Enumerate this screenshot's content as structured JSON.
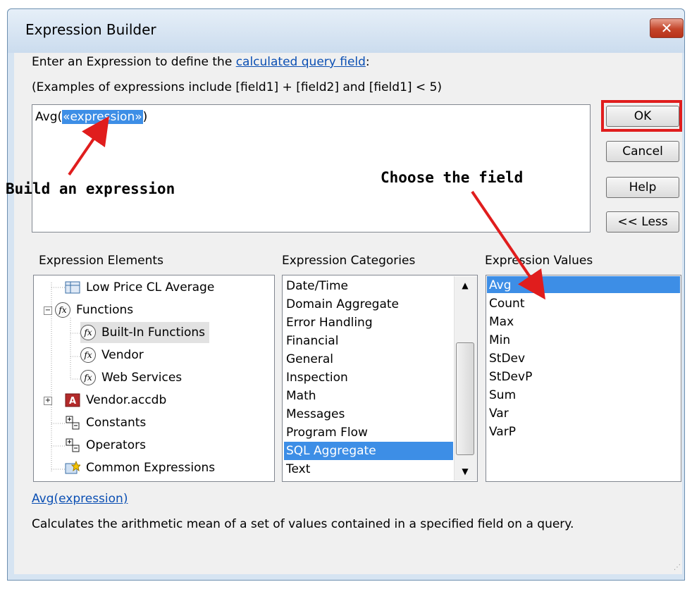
{
  "window": {
    "title": "Expression Builder",
    "close_glyph": "✕"
  },
  "intro": {
    "line1_prefix": "Enter an Expression to define the ",
    "line1_link": "calculated query field",
    "line1_suffix": ":",
    "line2": "(Examples of expressions include [field1] + [field2] and [field1] < 5)"
  },
  "expression": {
    "prefix": "Avg(",
    "placeholder": "«expression»",
    "suffix": ")"
  },
  "buttons": {
    "ok": "OK",
    "cancel": "Cancel",
    "help": "Help",
    "less": "<< Less"
  },
  "annotations": {
    "build": "Build an expression",
    "choose": "Choose the field",
    "arrow_color": "#e01d1d"
  },
  "sections": {
    "elements": "Expression Elements",
    "categories": "Expression Categories",
    "values": "Expression Values"
  },
  "tree": [
    {
      "label": "Low Price CL Average",
      "icon": "query-icon"
    },
    {
      "label": "Functions",
      "icon": "function-icon"
    },
    {
      "label": "Built-In Functions",
      "icon": "function-icon"
    },
    {
      "label": "Vendor",
      "icon": "function-icon"
    },
    {
      "label": "Web Services",
      "icon": "function-icon"
    },
    {
      "label": "Vendor.accdb",
      "icon": "access-database-icon"
    },
    {
      "label": "Constants",
      "icon": "constants-icon"
    },
    {
      "label": "Operators",
      "icon": "operators-icon"
    },
    {
      "label": "Common Expressions",
      "icon": "common-expressions-icon"
    }
  ],
  "categories": [
    "Date/Time",
    "Domain Aggregate",
    "Error Handling",
    "Financial",
    "General",
    "Inspection",
    "Math",
    "Messages",
    "Program Flow",
    "SQL Aggregate",
    "Text"
  ],
  "categories_selected": "SQL Aggregate",
  "values": [
    "Avg",
    "Count",
    "Max",
    "Min",
    "StDev",
    "StDevP",
    "Sum",
    "Var",
    "VarP"
  ],
  "values_selected": "Avg",
  "function_help": {
    "signature": "Avg(expression)",
    "description": "Calculates the arithmetic mean of a set of values contained in a specified field on a query."
  },
  "colors": {
    "selection": "#3d8ee6",
    "highlight_border": "#e01d1d",
    "link": "#0b4fb3"
  }
}
